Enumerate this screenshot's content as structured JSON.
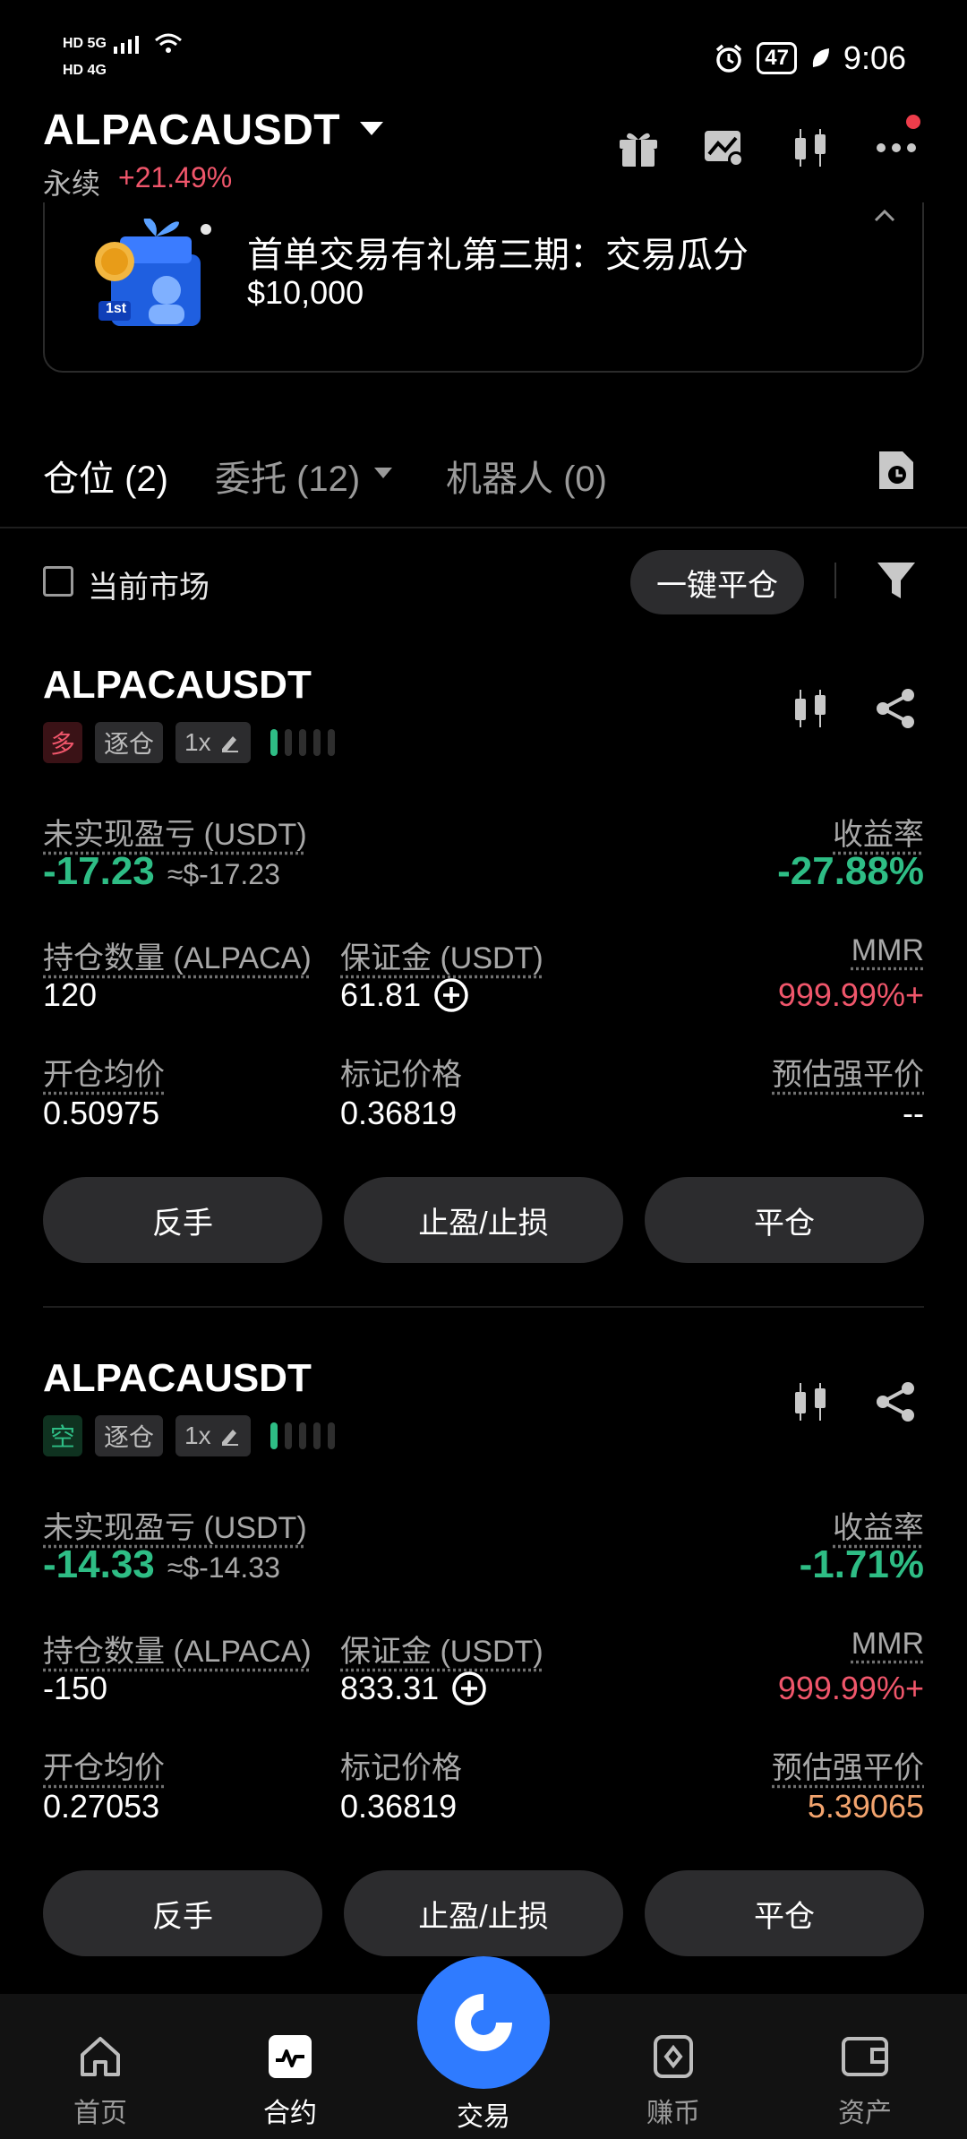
{
  "status_bar": {
    "sim1": "HD 5G",
    "sim2": "HD 4G",
    "battery": "47",
    "time": "9:06"
  },
  "header": {
    "pair": "ALPACAUSDT",
    "type": "永续",
    "change": "+21.49%"
  },
  "banner": {
    "title": "首单交易有礼第三期：交易瓜分",
    "amount": "$10,000",
    "badge": "1st"
  },
  "tabs": [
    {
      "label": "仓位 (2)"
    },
    {
      "label": "委托 (12)"
    },
    {
      "label": "机器人 (0)"
    }
  ],
  "filter": {
    "current_market": "当前市场",
    "close_all": "一键平仓"
  },
  "positions": [
    {
      "symbol": "ALPACAUSDT",
      "side": "多",
      "margin_mode": "逐仓",
      "leverage": "1x",
      "leverage_level": 1,
      "pnl_label": "未实现盈亏 (USDT)",
      "pnl": "-17.23",
      "pnl_usd": "≈$-17.23",
      "roe_label": "收益率",
      "roe": "-27.88%",
      "size_label": "持仓数量 (ALPACA)",
      "size": "120",
      "margin_label": "保证金 (USDT)",
      "margin": "61.81",
      "mmr_label": "MMR",
      "mmr": "999.99%+",
      "entry_label": "开仓均价",
      "entry": "0.50975",
      "mark_label": "标记价格",
      "mark": "0.36819",
      "liq_label": "预估强平价",
      "liq": "--",
      "btn_reverse": "反手",
      "btn_tpsl": "止盈/止损",
      "btn_close": "平仓"
    },
    {
      "symbol": "ALPACAUSDT",
      "side": "空",
      "margin_mode": "逐仓",
      "leverage": "1x",
      "leverage_level": 1,
      "pnl_label": "未实现盈亏 (USDT)",
      "pnl": "-14.33",
      "pnl_usd": "≈$-14.33",
      "roe_label": "收益率",
      "roe": "-1.71%",
      "size_label": "持仓数量 (ALPACA)",
      "size": "-150",
      "margin_label": "保证金 (USDT)",
      "margin": "833.31",
      "mmr_label": "MMR",
      "mmr": "999.99%+",
      "entry_label": "开仓均价",
      "entry": "0.27053",
      "mark_label": "标记价格",
      "mark": "0.36819",
      "liq_label": "预估强平价",
      "liq": "5.39065",
      "btn_reverse": "反手",
      "btn_tpsl": "止盈/止损",
      "btn_close": "平仓"
    }
  ],
  "nav": [
    {
      "label": "首页",
      "icon": "home-icon"
    },
    {
      "label": "合约",
      "icon": "futures-icon"
    },
    {
      "label": "交易",
      "icon": "trade-icon"
    },
    {
      "label": "赚币",
      "icon": "earn-icon"
    },
    {
      "label": "资产",
      "icon": "wallet-icon"
    }
  ],
  "colors": {
    "up": "#2ebd85",
    "down": "#f0566b",
    "warn": "#f3a46e",
    "accent": "#2f7bff"
  }
}
